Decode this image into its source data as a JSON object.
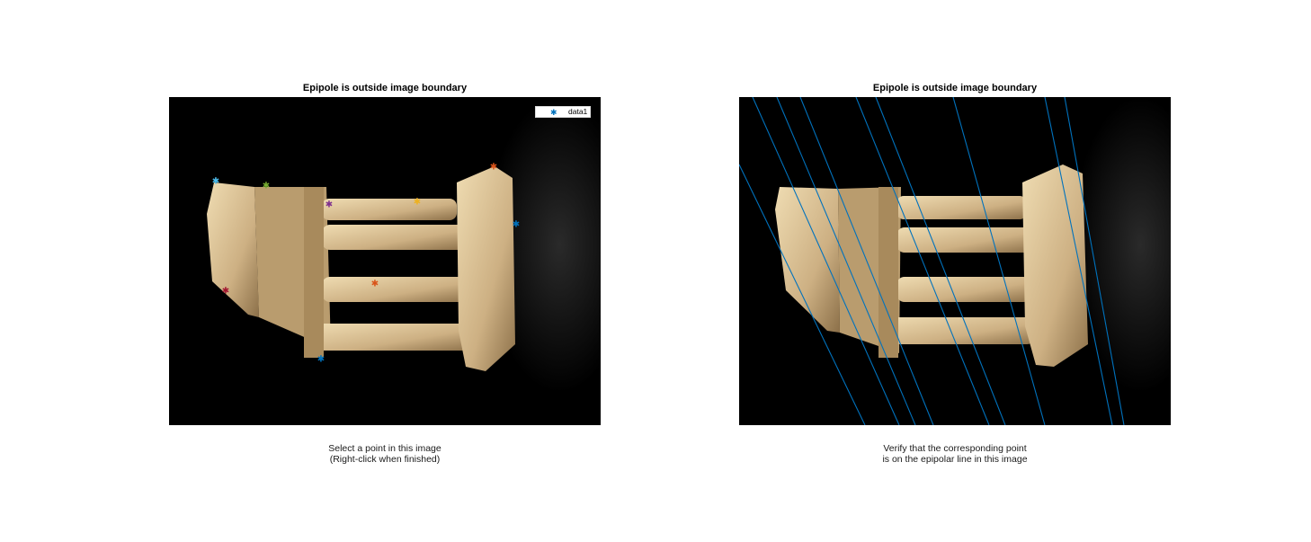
{
  "left_panel": {
    "title": "Epipole is outside image boundary",
    "caption_line1": "Select a point in this image",
    "caption_line2": "(Right-click when finished)",
    "legend": {
      "label": "data1",
      "marker": "✱",
      "marker_color": "#0072bd"
    },
    "points": [
      {
        "color": "#4dbeee"
      },
      {
        "color": "#77ac30"
      },
      {
        "color": "#7e2f8e"
      },
      {
        "color": "#edb120"
      },
      {
        "color": "#d95319"
      },
      {
        "color": "#0072bd"
      },
      {
        "color": "#a2142f"
      },
      {
        "color": "#d95319"
      },
      {
        "color": "#0072bd"
      }
    ]
  },
  "right_panel": {
    "title": "Epipole is outside image boundary",
    "caption_line1": "Verify that the corresponding point",
    "caption_line2": "is on the epipolar line in this image",
    "epipolar_line_color": "#0072bd",
    "epipolar_line_count": 9
  },
  "colors": {
    "background": "#ffffff",
    "axes_background": "#000000",
    "object_light": "#e6d0a2",
    "object_mid": "#c9ad7e",
    "object_shadow": "#6b5536"
  }
}
